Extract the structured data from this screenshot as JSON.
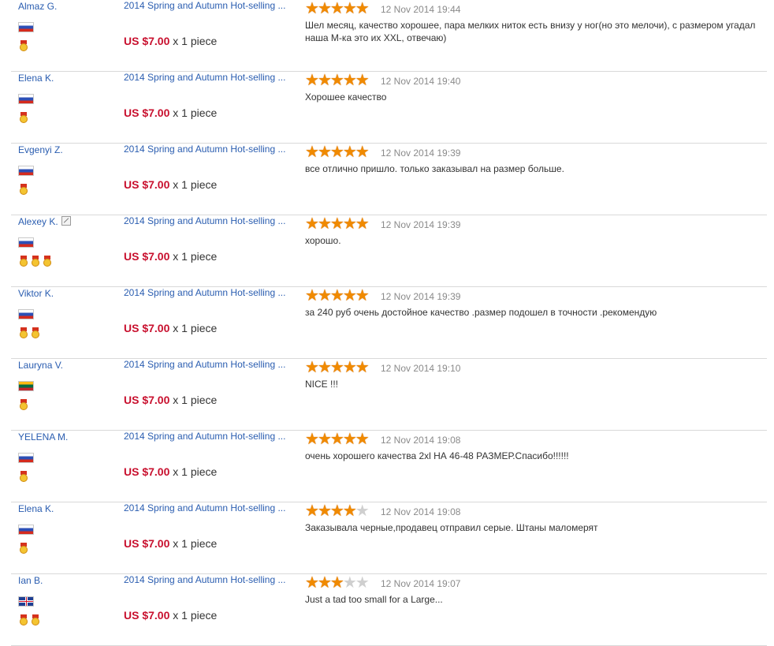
{
  "reviews": [
    {
      "user": "Almaz G.",
      "flag": "ru",
      "medals": 1,
      "verified": false,
      "product": "2014 Spring and Autumn Hot-selling ...",
      "price": "US $7.00",
      "qty": "x 1 piece",
      "stars": 5,
      "date": "12 Nov 2014 19:44",
      "text": "Шел месяц, качество хорошее, пара мелких ниток есть внизу у ног(но это мелочи), с размером угадал наша М-ка это их XXL, отвечаю)"
    },
    {
      "user": "Elena K.",
      "flag": "ru",
      "medals": 1,
      "verified": false,
      "product": "2014 Spring and Autumn Hot-selling ...",
      "price": "US $7.00",
      "qty": "x 1 piece",
      "stars": 5,
      "date": "12 Nov 2014 19:40",
      "text": "Хорошее качество"
    },
    {
      "user": "Evgenyi Z.",
      "flag": "ru",
      "medals": 1,
      "verified": false,
      "product": "2014 Spring and Autumn Hot-selling ...",
      "price": "US $7.00",
      "qty": "x 1 piece",
      "stars": 5,
      "date": "12 Nov 2014 19:39",
      "text": "все отлично пришло. только заказывал на размер больше."
    },
    {
      "user": "Alexey K.",
      "flag": "ru",
      "medals": 3,
      "verified": true,
      "product": "2014 Spring and Autumn Hot-selling ...",
      "price": "US $7.00",
      "qty": "x 1 piece",
      "stars": 5,
      "date": "12 Nov 2014 19:39",
      "text": "хорошо."
    },
    {
      "user": "Viktor K.",
      "flag": "ru",
      "medals": 2,
      "verified": false,
      "product": "2014 Spring and Autumn Hot-selling ...",
      "price": "US $7.00",
      "qty": "x 1 piece",
      "stars": 5,
      "date": "12 Nov 2014 19:39",
      "text": "за 240 руб очень достойное качество .размер подошел в точности .рекомендую"
    },
    {
      "user": "Lauryna V.",
      "flag": "lt",
      "medals": 1,
      "verified": false,
      "product": "2014 Spring and Autumn Hot-selling ...",
      "price": "US $7.00",
      "qty": "x 1 piece",
      "stars": 5,
      "date": "12 Nov 2014 19:10",
      "text": "NICE !!!"
    },
    {
      "user": "YELENA M.",
      "flag": "ru",
      "medals": 1,
      "verified": false,
      "product": "2014 Spring and Autumn Hot-selling ...",
      "price": "US $7.00",
      "qty": "x 1 piece",
      "stars": 5,
      "date": "12 Nov 2014 19:08",
      "text": "очень хорошего качества 2xl НА 46-48 РАЗМЕР.Спасибо!!!!!!"
    },
    {
      "user": "Elena K.",
      "flag": "ru",
      "medals": 1,
      "verified": false,
      "product": "2014 Spring and Autumn Hot-selling ...",
      "price": "US $7.00",
      "qty": "x 1 piece",
      "stars": 4,
      "date": "12 Nov 2014 19:08",
      "text": "Заказывала черные,продавец отправил серые. Штаны маломерят"
    },
    {
      "user": "Ian B.",
      "flag": "gb",
      "medals": 2,
      "verified": false,
      "product": "2014 Spring and Autumn Hot-selling ...",
      "price": "US $7.00",
      "qty": "x 1 piece",
      "stars": 3,
      "date": "12 Nov 2014 19:07",
      "text": "Just a tad too small for a Large..."
    }
  ],
  "max_stars": 5,
  "colors": {
    "link": "#2a5db0",
    "price": "#c8102e",
    "star": "#f08a00",
    "star_off": "#cfcfcf"
  }
}
